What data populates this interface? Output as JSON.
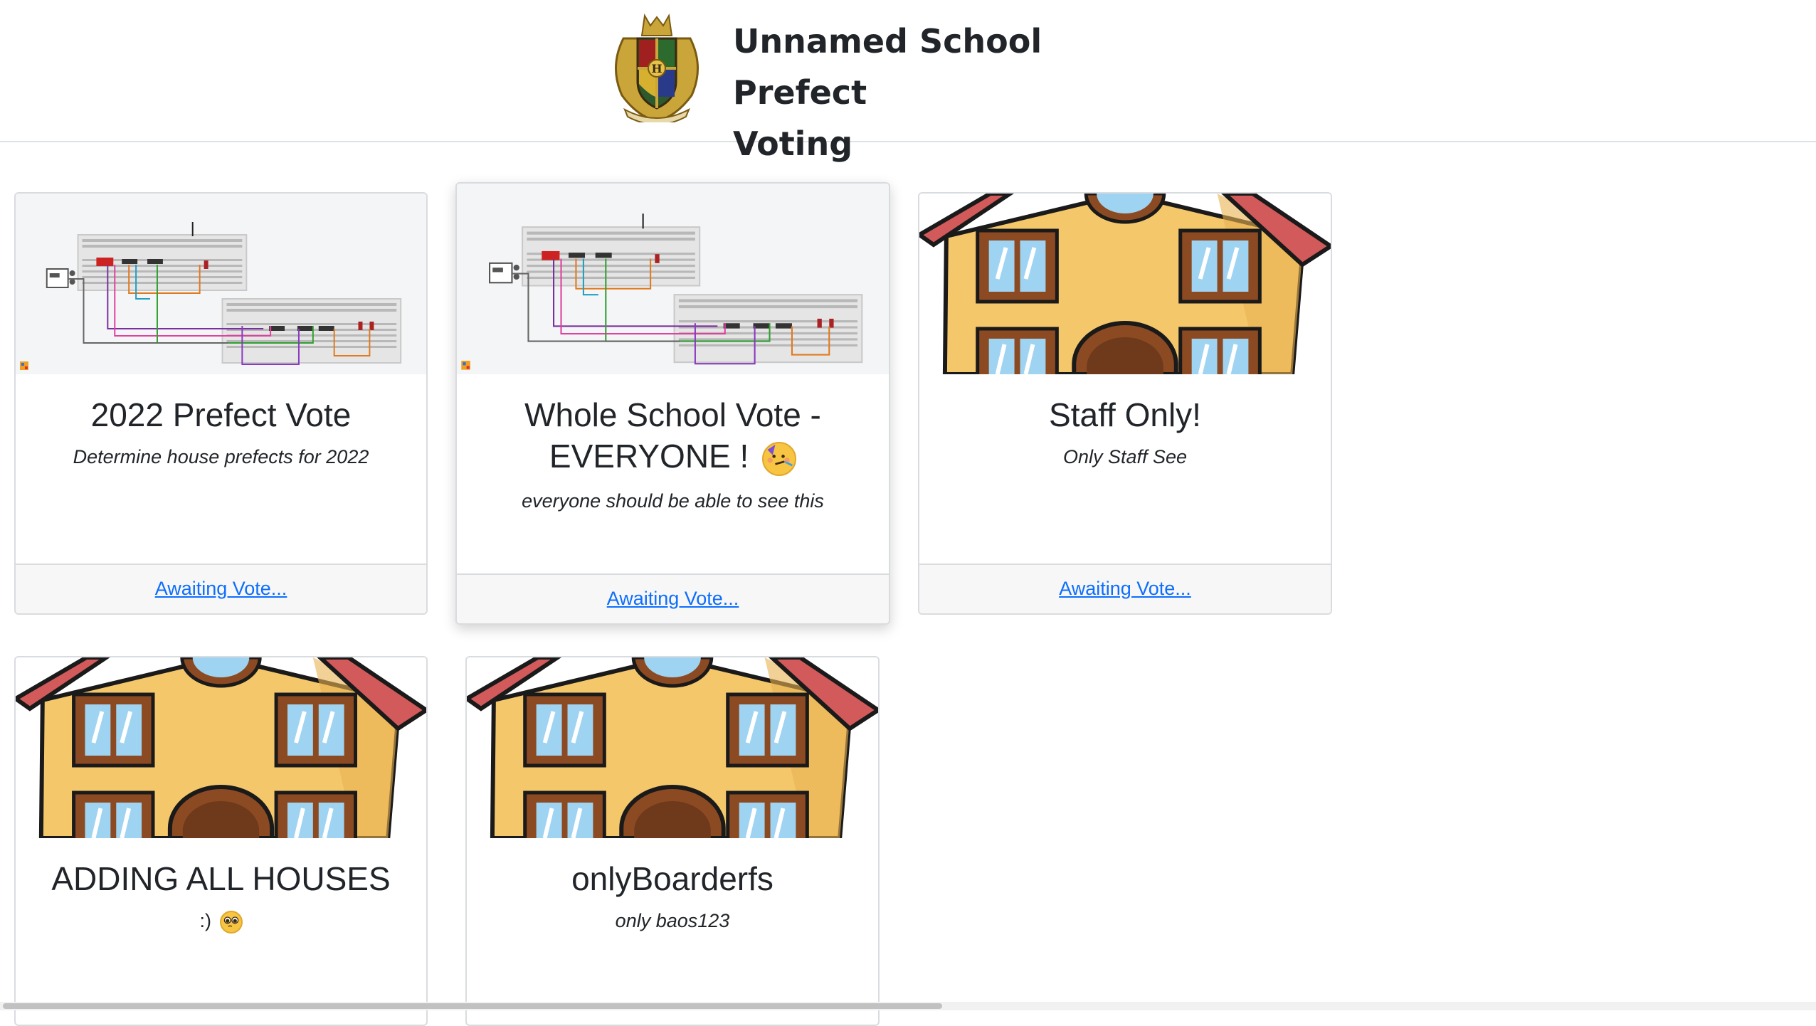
{
  "header": {
    "logo_icon": "hogwarts-crest-icon",
    "title_line1": "Unnamed School Prefect",
    "title_line2": "Voting"
  },
  "cards": [
    {
      "image": "breadboard-circuit",
      "title": "2022 Prefect Vote",
      "description": "Determine house prefects for 2022",
      "footer_link": "Awaiting Vote..."
    },
    {
      "image": "breadboard-circuit",
      "title_line1": "Whole School Vote -",
      "title_line2": "EVERYONE !",
      "title_emoji": "partying-face-icon",
      "description": "everyone should be able to see this",
      "footer_link": "Awaiting Vote..."
    },
    {
      "image": "house-cartoon",
      "title": "Staff Only!",
      "description": "Only Staff See",
      "footer_link": "Awaiting Vote..."
    },
    {
      "image": "house-cartoon",
      "title": "ADDING ALL HOUSES",
      "description": ":)",
      "description_emoji": "pleading-face-icon"
    },
    {
      "image": "house-cartoon",
      "title": "onlyBoarderfs",
      "description": "only baos123"
    }
  ],
  "colors": {
    "link": "#0d6efd",
    "border": "#d9dcdf",
    "footer_bg": "#f7f7f7",
    "house_wall": "#f5c76b",
    "house_roof": "#d25a5a",
    "window_frame": "#8b4a22",
    "window_glass": "#9fd3f2"
  }
}
